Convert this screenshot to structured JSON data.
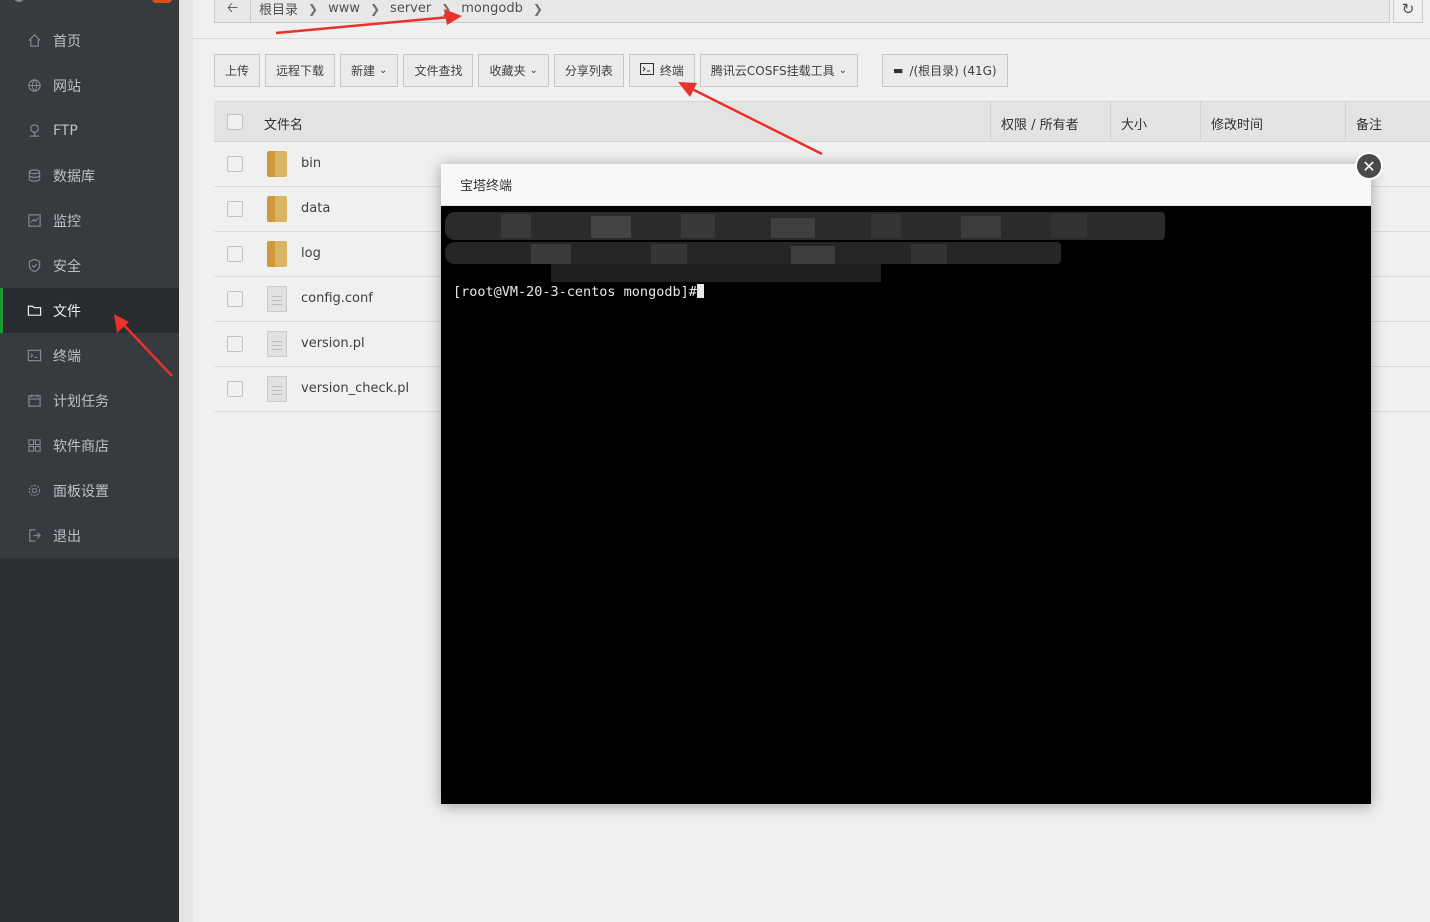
{
  "sidebar": {
    "items": [
      {
        "label": "首页",
        "icon": "home-icon"
      },
      {
        "label": "网站",
        "icon": "globe-icon"
      },
      {
        "label": "FTP",
        "icon": "ftp-icon"
      },
      {
        "label": "数据库",
        "icon": "database-icon"
      },
      {
        "label": "监控",
        "icon": "monitor-icon"
      },
      {
        "label": "安全",
        "icon": "shield-icon"
      },
      {
        "label": "文件",
        "icon": "folder-icon",
        "active": true
      },
      {
        "label": "终端",
        "icon": "terminal-icon"
      },
      {
        "label": "计划任务",
        "icon": "calendar-icon"
      },
      {
        "label": "软件商店",
        "icon": "grid-icon"
      },
      {
        "label": "面板设置",
        "icon": "gear-icon"
      },
      {
        "label": "退出",
        "icon": "logout-icon"
      }
    ]
  },
  "breadcrumb": {
    "items": [
      "根目录",
      "www",
      "server",
      "mongodb"
    ]
  },
  "toolbar": {
    "upload": "上传",
    "remote_download": "远程下载",
    "new": "新建",
    "file_search": "文件查找",
    "favorites": "收藏夹",
    "share_list": "分享列表",
    "terminal": "终端",
    "cosfs": "腾讯云COSFS挂载工具",
    "disk": "/(根目录) (41G)"
  },
  "table": {
    "headers": {
      "name": "文件名",
      "perm": "权限 / 所有者",
      "size": "大小",
      "mtime": "修改时间",
      "note": "备注"
    },
    "rows": [
      {
        "name": "bin",
        "type": "folder"
      },
      {
        "name": "data",
        "type": "folder"
      },
      {
        "name": "log",
        "type": "folder"
      },
      {
        "name": "config.conf",
        "type": "file"
      },
      {
        "name": "version.pl",
        "type": "file"
      },
      {
        "name": "version_check.pl",
        "type": "file"
      }
    ]
  },
  "dialog": {
    "title": "宝塔终端",
    "terminal_prompt": "[root@VM-20-3-centos mongodb]#"
  },
  "colors": {
    "sidebar_bg": "#3b3f45",
    "active_accent": "#20a53a",
    "annotation_arrow": "#e8322b",
    "terminal_bg": "#000000"
  }
}
